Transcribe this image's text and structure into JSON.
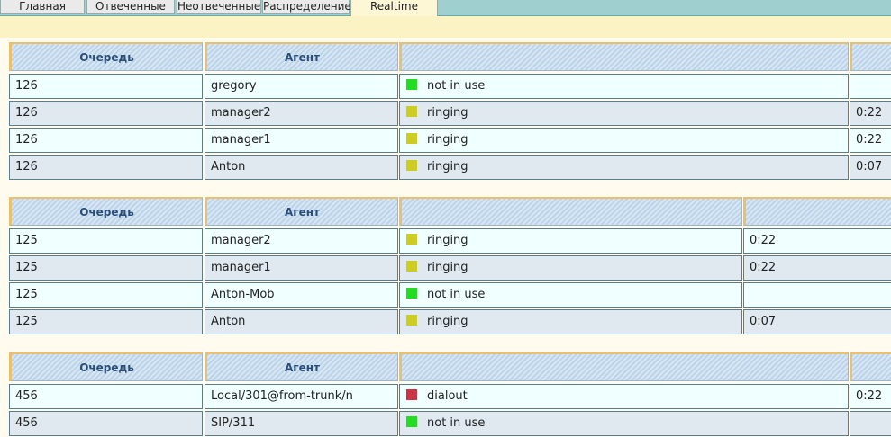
{
  "tabs": [
    {
      "label": "Главная"
    },
    {
      "label": "Отвеченные"
    },
    {
      "label": "Неотвеченные"
    },
    {
      "label": "Распределение"
    },
    {
      "label": "Realtime"
    }
  ],
  "colors": {
    "not in use": "#22dd22",
    "ringing": "#cccc22",
    "dialout": "#cc3344"
  },
  "blocks": [
    {
      "headers": {
        "queue": "Очередь",
        "agent": "Агент"
      },
      "rows": [
        {
          "queue": "126",
          "agent": "gregory",
          "status": "not in use",
          "time": ""
        },
        {
          "queue": "126",
          "agent": "manager2",
          "status": "ringing",
          "time": "0:22"
        },
        {
          "queue": "126",
          "agent": "manager1",
          "status": "ringing",
          "time": "0:22"
        },
        {
          "queue": "126",
          "agent": "Anton",
          "status": "ringing",
          "time": "0:07"
        }
      ]
    },
    {
      "headers": {
        "queue": "Очередь",
        "agent": "Агент"
      },
      "rows": [
        {
          "queue": "125",
          "agent": "manager2",
          "status": "ringing",
          "time": "0:22"
        },
        {
          "queue": "125",
          "agent": "manager1",
          "status": "ringing",
          "time": "0:22"
        },
        {
          "queue": "125",
          "agent": "Anton-Mob",
          "status": "not in use",
          "time": ""
        },
        {
          "queue": "125",
          "agent": "Anton",
          "status": "ringing",
          "time": "0:07"
        }
      ]
    },
    {
      "headers": {
        "queue": "Очередь",
        "agent": "Агент"
      },
      "rows": [
        {
          "queue": "456",
          "agent": "Local/301@from-trunk/n",
          "status": "dialout",
          "time": "0:22"
        },
        {
          "queue": "456",
          "agent": "SIP/311",
          "status": "not in use",
          "time": ""
        }
      ]
    }
  ]
}
